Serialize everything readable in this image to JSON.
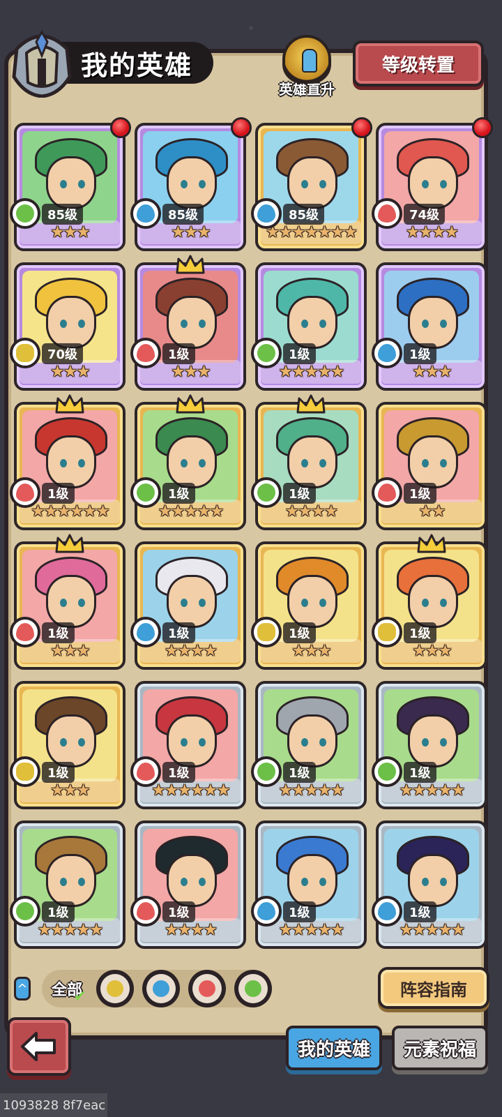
{
  "header": {
    "title": "我的英雄"
  },
  "ascend": {
    "label": "英雄直升"
  },
  "reset_button": {
    "label": "等级转置"
  },
  "heroes": [
    {
      "level": "85级",
      "element": "nature",
      "frame": "purple",
      "stars": "★★★",
      "red_dot": true,
      "crown": false,
      "bg": "#8fd48c",
      "hair": "#3f9a5a"
    },
    {
      "level": "85级",
      "element": "water",
      "frame": "purple",
      "stars": "★★★",
      "red_dot": true,
      "crown": false,
      "bg": "#8bd0ef",
      "hair": "#2e8fc7"
    },
    {
      "level": "85级",
      "element": "water",
      "frame": "gold",
      "stars": "★★★★★★★",
      "red_dot": true,
      "crown": false,
      "bg": "#9cd8ea",
      "hair": "#8a5a35"
    },
    {
      "level": "74级",
      "element": "fire",
      "frame": "purple",
      "stars": "★★★★",
      "red_dot": true,
      "crown": false,
      "bg": "#f3a7a7",
      "hair": "#e0584f"
    },
    {
      "level": "70级",
      "element": "earth",
      "frame": "purple",
      "stars": "★★★",
      "red_dot": false,
      "crown": false,
      "bg": "#f5e48a",
      "hair": "#f0c23e"
    },
    {
      "level": "1级",
      "element": "fire",
      "frame": "purple",
      "stars": "★★★",
      "red_dot": false,
      "crown": true,
      "bg": "#e98a8a",
      "hair": "#8a4030"
    },
    {
      "level": "1级",
      "element": "nature",
      "frame": "purple",
      "stars": "★★★★★",
      "red_dot": false,
      "crown": false,
      "bg": "#9cdcd0",
      "hair": "#4fb7a8"
    },
    {
      "level": "1级",
      "element": "water",
      "frame": "purple",
      "stars": "★★★",
      "red_dot": false,
      "crown": false,
      "bg": "#9ccdef",
      "hair": "#2d6fc2"
    },
    {
      "level": "1级",
      "element": "fire",
      "frame": "gold",
      "stars": "★★★★★★",
      "red_dot": false,
      "crown": true,
      "bg": "#f3a7a7",
      "hair": "#c8372f"
    },
    {
      "level": "1级",
      "element": "nature",
      "frame": "gold",
      "stars": "★★★★★",
      "red_dot": false,
      "crown": true,
      "bg": "#a8dc8c",
      "hair": "#3b8a4f"
    },
    {
      "level": "1级",
      "element": "nature",
      "frame": "gold",
      "stars": "★★★★",
      "red_dot": false,
      "crown": true,
      "bg": "#a8dcc0",
      "hair": "#4fb08a"
    },
    {
      "level": "1级",
      "element": "fire",
      "frame": "gold",
      "stars": "★★",
      "red_dot": false,
      "crown": false,
      "bg": "#f3a7a7",
      "hair": "#c89a30"
    },
    {
      "level": "1级",
      "element": "fire",
      "frame": "gold",
      "stars": "★★★",
      "red_dot": false,
      "crown": true,
      "bg": "#f3a7a7",
      "hair": "#e06a9a"
    },
    {
      "level": "1级",
      "element": "water",
      "frame": "gold",
      "stars": "★★★★",
      "red_dot": false,
      "crown": false,
      "bg": "#9cd3ea",
      "hair": "#e8e8ee"
    },
    {
      "level": "1级",
      "element": "earth",
      "frame": "gold",
      "stars": "★★★",
      "red_dot": false,
      "crown": false,
      "bg": "#f4e28a",
      "hair": "#e08a2a"
    },
    {
      "level": "1级",
      "element": "earth",
      "frame": "gold",
      "stars": "★★★",
      "red_dot": false,
      "crown": true,
      "bg": "#f4e28a",
      "hair": "#e8703a"
    },
    {
      "level": "1级",
      "element": "earth",
      "frame": "gold",
      "stars": "★★★",
      "red_dot": false,
      "crown": false,
      "bg": "#f4e28a",
      "hair": "#6b4628"
    },
    {
      "level": "1级",
      "element": "fire",
      "frame": "gray",
      "stars": "★★★★★★",
      "red_dot": false,
      "crown": false,
      "bg": "#f3a7a7",
      "hair": "#c8373f"
    },
    {
      "level": "1级",
      "element": "nature",
      "frame": "gray",
      "stars": "★★★★★",
      "red_dot": false,
      "crown": false,
      "bg": "#a8dc8c",
      "hair": "#a0a6ae"
    },
    {
      "level": "1级",
      "element": "nature",
      "frame": "gray",
      "stars": "★★★★★",
      "red_dot": false,
      "crown": false,
      "bg": "#a8dc8c",
      "hair": "#3a2a4e"
    },
    {
      "level": "1级",
      "element": "nature",
      "frame": "gray",
      "stars": "★★★★★",
      "red_dot": false,
      "crown": false,
      "bg": "#a8dc8c",
      "hair": "#a8783a"
    },
    {
      "level": "1级",
      "element": "fire",
      "frame": "gray",
      "stars": "★★★★",
      "red_dot": false,
      "crown": false,
      "bg": "#f3a7a7",
      "hair": "#1e2a2e"
    },
    {
      "level": "1级",
      "element": "water",
      "frame": "gray",
      "stars": "★★★★★",
      "red_dot": false,
      "crown": false,
      "bg": "#9cd3ea",
      "hair": "#3a7ad0"
    },
    {
      "level": "1级",
      "element": "water",
      "frame": "gray",
      "stars": "★★★★★",
      "red_dot": false,
      "crown": false,
      "bg": "#9cd3ea",
      "hair": "#2a2458"
    }
  ],
  "filters": {
    "all_label": "全部",
    "all_check": "✔",
    "collapse_icon": "^",
    "elements": [
      "earth",
      "water",
      "fire",
      "nature"
    ]
  },
  "element_colors": {
    "nature": "#6cc047",
    "water": "#3f9fd8",
    "fire": "#e45a5a",
    "earth": "#e0bf3a"
  },
  "guide_button": {
    "label": "阵容指南"
  },
  "tabs": {
    "my_heroes": "我的英雄",
    "element_blessing": "元素祝福"
  },
  "watermark": "1093828 8f7eac"
}
